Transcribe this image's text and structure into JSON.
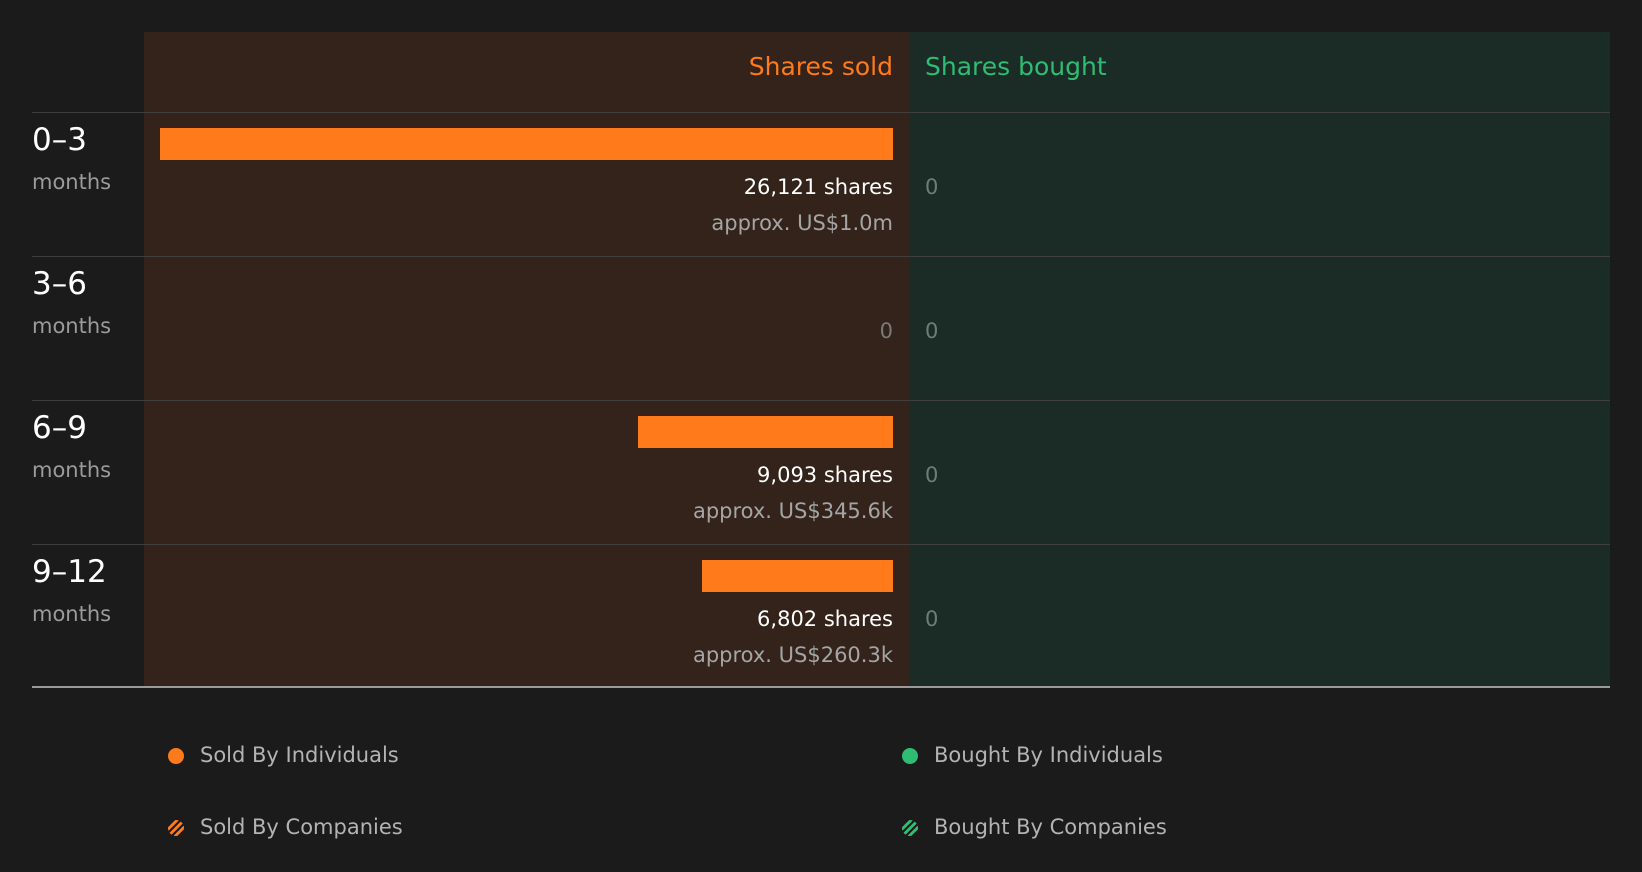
{
  "chart_data": {
    "type": "bar",
    "orientation": "horizontal",
    "headers": {
      "sold": "Shares sold",
      "bought": "Shares bought"
    },
    "categories": [
      {
        "range": "0–3",
        "unit": "months"
      },
      {
        "range": "3–6",
        "unit": "months"
      },
      {
        "range": "6–9",
        "unit": "months"
      },
      {
        "range": "9–12",
        "unit": "months"
      }
    ],
    "series": [
      {
        "name": "Shares sold",
        "values": [
          26121,
          0,
          9093,
          6802
        ],
        "labels": [
          "26,121 shares",
          "0",
          "9,093 shares",
          "6,802 shares"
        ],
        "value_labels": [
          "approx. US$1.0m",
          "",
          "approx. US$345.6k",
          "approx. US$260.3k"
        ]
      },
      {
        "name": "Shares bought",
        "values": [
          0,
          0,
          0,
          0
        ],
        "labels": [
          "0",
          "0",
          "0",
          "0"
        ]
      }
    ],
    "legend": [
      {
        "label": "Sold By Individuals",
        "style": "solid",
        "color": "#ff7a1a"
      },
      {
        "label": "Bought By Individuals",
        "style": "solid",
        "color": "#2ebd73"
      },
      {
        "label": "Sold By Companies",
        "style": "hatched",
        "color": "#ff7a1a"
      },
      {
        "label": "Bought By Companies",
        "style": "hatched",
        "color": "#2ebd73"
      }
    ],
    "colors": {
      "sold": "#ff7a1a",
      "bought": "#2ebd73"
    }
  }
}
